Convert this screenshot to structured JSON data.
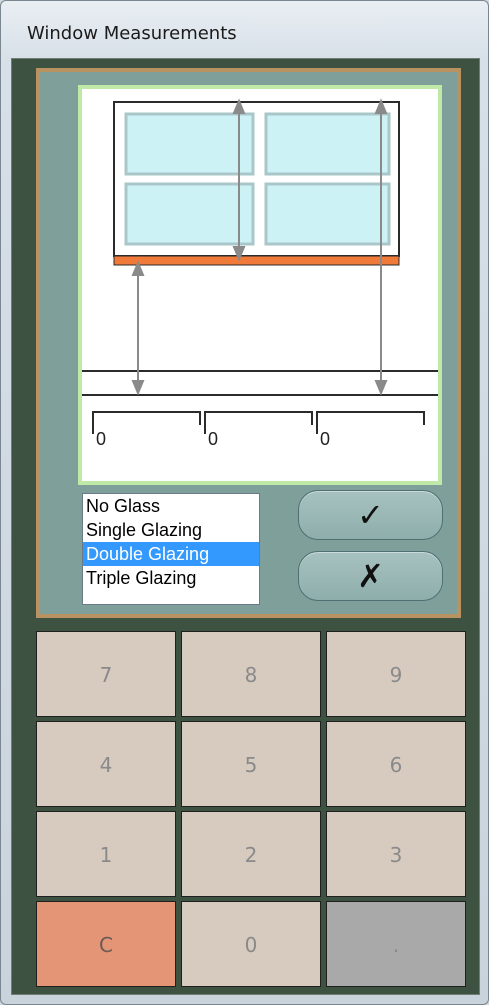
{
  "window": {
    "title": "Window Measurements"
  },
  "diagram": {
    "measure_values": [
      "0",
      "0",
      "0"
    ]
  },
  "glazing": {
    "options": [
      "No Glass",
      "Single Glazing",
      "Double Glazing",
      "Triple Glazing"
    ],
    "selected": "Double Glazing"
  },
  "actions": {
    "confirm_icon": "checkmark-icon",
    "cancel_icon": "x-mark-icon",
    "confirm_glyph": "✓",
    "cancel_glyph": "✗"
  },
  "keypad": {
    "keys": [
      "7",
      "8",
      "9",
      "4",
      "5",
      "6",
      "1",
      "2",
      "3",
      "C",
      "0",
      "."
    ]
  },
  "colors": {
    "sill": "#f07a3a",
    "glass": "#cdf2f6",
    "frame_border": "#b89260",
    "panel": "#7f9f9b",
    "clear_key": "#e39575",
    "dot_key": "#a9a9a9",
    "selection": "#3399ff"
  }
}
